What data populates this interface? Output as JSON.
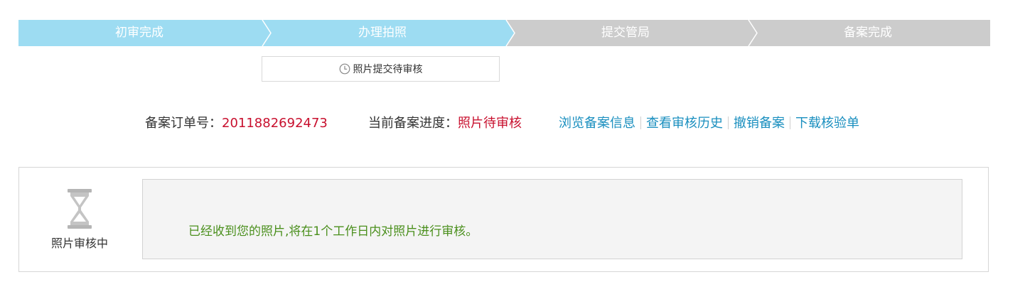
{
  "steps": [
    {
      "label": "初审完成",
      "state": "done"
    },
    {
      "label": "办理拍照",
      "state": "current"
    },
    {
      "label": "提交管局",
      "state": "pending"
    },
    {
      "label": "备案完成",
      "state": "pending"
    }
  ],
  "colors": {
    "step_active": "#9ddcf2",
    "step_pending": "#cccccc",
    "accent_red": "#c8102e",
    "link": "#1a8fbf",
    "message_green": "#4a8f1c"
  },
  "sub_status": {
    "icon": "clock-icon",
    "text": "照片提交待审核"
  },
  "order": {
    "label": "备案订单号：",
    "value": "2011882692473"
  },
  "progress": {
    "label": "当前备案进度：",
    "value": "照片待审核"
  },
  "links": [
    "浏览备案信息",
    "查看审核历史",
    "撤销备案",
    "下载核验单"
  ],
  "panel": {
    "icon": "hourglass-icon",
    "state_label": "照片审核中",
    "message": "已经收到您的照片,将在1个工作日内对照片进行审核。"
  }
}
